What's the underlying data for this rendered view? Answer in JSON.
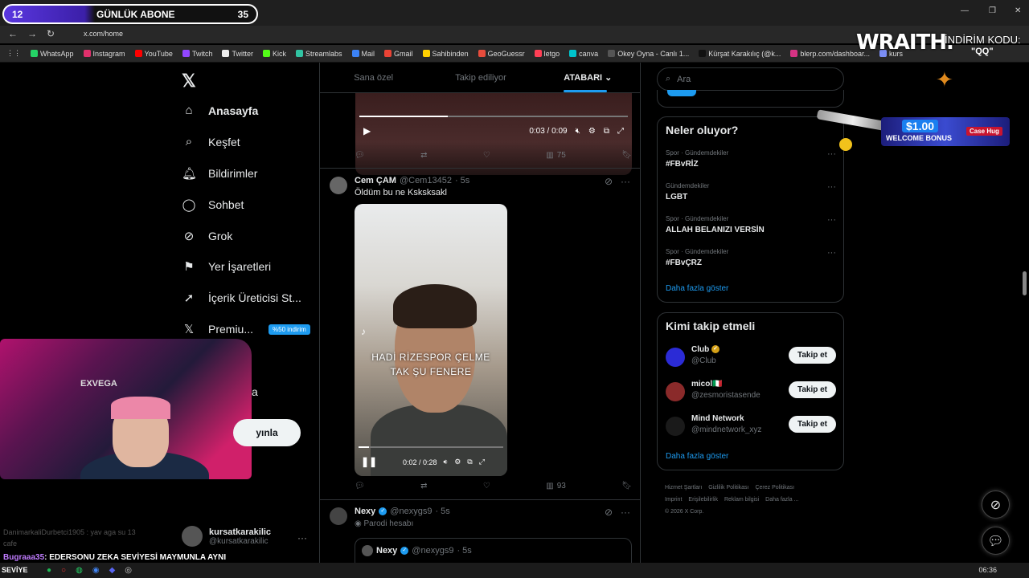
{
  "browser": {
    "url": "x.com/home",
    "bookmarks": [
      "WhatsApp",
      "Instagram",
      "YouTube",
      "Twitch",
      "Twitter",
      "Kick",
      "Streamlabs",
      "Mail",
      "Gmail",
      "Sahibinden",
      "GeoGuessr",
      "letgo",
      "canva",
      "Okey Oyna - Canlı 1...",
      "Kürşat Karakılıç (@k...",
      "blerp.com/dashboar...",
      "kurs"
    ],
    "bookmarks_right": "Yer İşaretleri"
  },
  "overlay": {
    "sub_current": "12",
    "sub_label": "GÜNLÜK ABONE",
    "sub_goal": "35",
    "sub_progress": 0.34,
    "sponsor": "WRAITH.",
    "code_label": "İNDİRİM KODU:",
    "code_value": "\"QQ\"",
    "cam_chair": "EXVEGA"
  },
  "nav": {
    "items": [
      {
        "label": "Anasayfa",
        "icon": "home-icon"
      },
      {
        "label": "Keşfet",
        "icon": "search-icon"
      },
      {
        "label": "Bildirimler",
        "icon": "bell-icon"
      },
      {
        "label": "Sohbet",
        "icon": "chat-icon"
      },
      {
        "label": "Grok",
        "icon": "grok-icon"
      },
      {
        "label": "Yer İşaretleri",
        "icon": "bookmark-icon"
      },
      {
        "label": "İçerik Üreticisi St...",
        "icon": "rocket-icon"
      },
      {
        "label": "Premiu...",
        "icon": "x-icon"
      }
    ],
    "promo": "%50 indirim",
    "hidden_partial": "a",
    "post_button": "yınla"
  },
  "account": {
    "name": "kursatkarakilic",
    "handle": "@kursatkarakilic"
  },
  "chat": {
    "faded": "DanimarkaliDurbetci1905 : yav aga su 13",
    "faded2": "cafe",
    "user": "Bugraaa35",
    "message": ": EDERSONU ZEKA SEVİYESİ MAYMUNLA AYNI"
  },
  "timeline": {
    "tabs": [
      "Sana özel",
      "Takip ediliyor",
      "ATABARI"
    ],
    "post1": {
      "time": "0:03 / 0:09",
      "progress": 0.33,
      "views": "75"
    },
    "post2": {
      "name": "Cem ÇAM",
      "handle": "@Cem13452",
      "age": "· 5s",
      "text": "Öldüm bu ne Ksksksakl",
      "caption1": "HADİ RİZESPOR ÇELME",
      "caption2": "TAK ŞU FENERE",
      "time": "0:02 / 0:28",
      "progress": 0.07,
      "views": "93"
    },
    "post3": {
      "name": "Nexy",
      "handle": "@nexygs9",
      "age": "· 5s",
      "tag": "Parodi hesabı",
      "quote_name": "Nexy",
      "quote_handle": "@nexygs9",
      "quote_age": "· 5s"
    }
  },
  "sidebar": {
    "search_placeholder": "Ara",
    "trends_title": "Neler oluyor?",
    "trends": [
      {
        "category": "Spor · Gündemdekiler",
        "name": "#FBvRİZ"
      },
      {
        "category": "Gündemdekiler",
        "name": "LGBT"
      },
      {
        "category": "Spor · Gündemdekiler",
        "name": "ALLAH BELANIZI VERSİN"
      },
      {
        "category": "Spor · Gündemdekiler",
        "name": "#FBvÇRZ"
      }
    ],
    "trends_more": "Daha fazla göster",
    "follow_title": "Kimi takip etmeli",
    "follow": [
      {
        "name": "Club",
        "handle": "@Club",
        "button": "Takip et",
        "color": "#2b2bd6"
      },
      {
        "name": "micol🇮🇹",
        "handle": "@zesmoristasende",
        "button": "Takip et",
        "color": "#8a2a2a"
      },
      {
        "name": "Mind Network",
        "handle": "@mindnetwork_xyz",
        "button": "Takip et",
        "color": "#1a1a1a"
      }
    ],
    "follow_more": "Daha fazla göster",
    "footer": [
      "Hizmet Şartları",
      "Gizlilik Politikası",
      "Çerez Politikası",
      "Imprint",
      "Erişilebilirlik",
      "Reklam bilgisi",
      "Daha fazla ...",
      "© 2026 X Corp."
    ]
  },
  "ad": {
    "amount": "$1.00",
    "text": "WELCOME BONUS",
    "brand": "Case Hug"
  },
  "taskbar": {
    "time": "06:36",
    "label": "SEVİYE"
  },
  "colors": {
    "accent": "#1d9bf0",
    "background": "#000000",
    "border": "#2f3336"
  }
}
